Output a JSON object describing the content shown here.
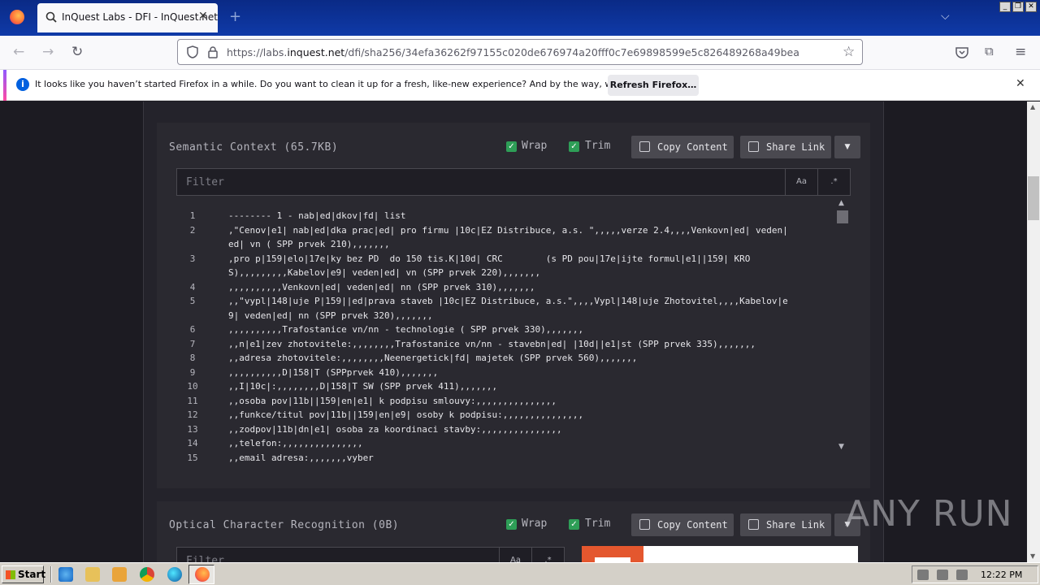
{
  "browser": {
    "tab_title": "InQuest Labs - DFI - InQuest.net",
    "url_prefix": "https://labs.",
    "url_domain": "inquest.net",
    "url_rest": "/dfi/sha256/34efa36262f97155c020de676974a20fff0c7e69898599e5c826489268a49bea",
    "notification_text": "It looks like you haven’t started Firefox in a while. Do you want to clean it up for a fresh, like-new experience? And by the way, welcome back!",
    "refresh_label": "Refresh Firefox…"
  },
  "semantic": {
    "title": "Semantic Context (65.7KB)",
    "wrap_label": "Wrap",
    "trim_label": "Trim",
    "copy_label": "Copy Content",
    "share_label": "Share Link",
    "filter_placeholder": "Filter",
    "case_option": "Aa",
    "regex_option": ".*",
    "lines": [
      {
        "n": "1",
        "text": "-------- 1 - nab|ed|dkov|fd| list"
      },
      {
        "n": "2",
        "text": ",\"Cenov|e1| nab|ed|dka prac|ed| pro firmu |10c|EZ Distribuce, a.s. \",,,,,verze 2.4,,,,Venkovn|ed| veden|ed| vn ( SPP prvek 210),,,,,,,"
      },
      {
        "n": "3",
        "text": ",pro p|159|elo|17e|ky bez PD  do 150 tis.K|10d| CRC        (s PD pou|17e|ijte formul|e1||159| KROS),,,,,,,,,Kabelov|e9| veden|ed| vn (SPP prvek 220),,,,,,,"
      },
      {
        "n": "4",
        "text": ",,,,,,,,,,Venkovn|ed| veden|ed| nn (SPP prvek 310),,,,,,,"
      },
      {
        "n": "5",
        "text": ",,\"vypl|148|uje P|159||ed|prava staveb |10c|EZ Distribuce, a.s.\",,,,Vypl|148|uje Zhotovitel,,,,Kabelov|e9| veden|ed| nn (SPP prvek 320),,,,,,,"
      },
      {
        "n": "6",
        "text": ",,,,,,,,,,Trafostanice vn/nn - technologie ( SPP prvek 330),,,,,,,"
      },
      {
        "n": "7",
        "text": ",,n|e1|zev zhotovitele:,,,,,,,,Trafostanice vn/nn - stavebn|ed| |10d||e1|st (SPP prvek 335),,,,,,,"
      },
      {
        "n": "8",
        "text": ",,adresa zhotovitele:,,,,,,,,Neenergetick|fd| majetek (SPP prvek 560),,,,,,,"
      },
      {
        "n": "9",
        "text": ",,,,,,,,,,D|158|T (SPPprvek 410),,,,,,,"
      },
      {
        "n": "10",
        "text": ",,I|10c|:,,,,,,,,D|158|T SW (SPP prvek 411),,,,,,,"
      },
      {
        "n": "11",
        "text": ",,osoba pov|11b||159|en|e1| k podpisu smlouvy:,,,,,,,,,,,,,,,"
      },
      {
        "n": "12",
        "text": ",,funkce/titul pov|11b||159|en|e9| osoby k podpisu:,,,,,,,,,,,,,,,"
      },
      {
        "n": "13",
        "text": ",,zodpov|11b|dn|e1| osoba za koordinaci stavby:,,,,,,,,,,,,,,,"
      },
      {
        "n": "14",
        "text": ",,telefon:,,,,,,,,,,,,,,,"
      },
      {
        "n": "15",
        "text": ",,email adresa:,,,,,,,vyber"
      }
    ]
  },
  "ocr": {
    "title": "Optical Character Recognition (0B)",
    "wrap_label": "Wrap",
    "trim_label": "Trim",
    "copy_label": "Copy Content",
    "share_label": "Share Link",
    "filter_placeholder": "Filter",
    "case_option": "Aa",
    "regex_option": ".*"
  },
  "watermark": "ANY RUN",
  "taskbar": {
    "start_label": "Start",
    "clock": "12:22 PM"
  }
}
